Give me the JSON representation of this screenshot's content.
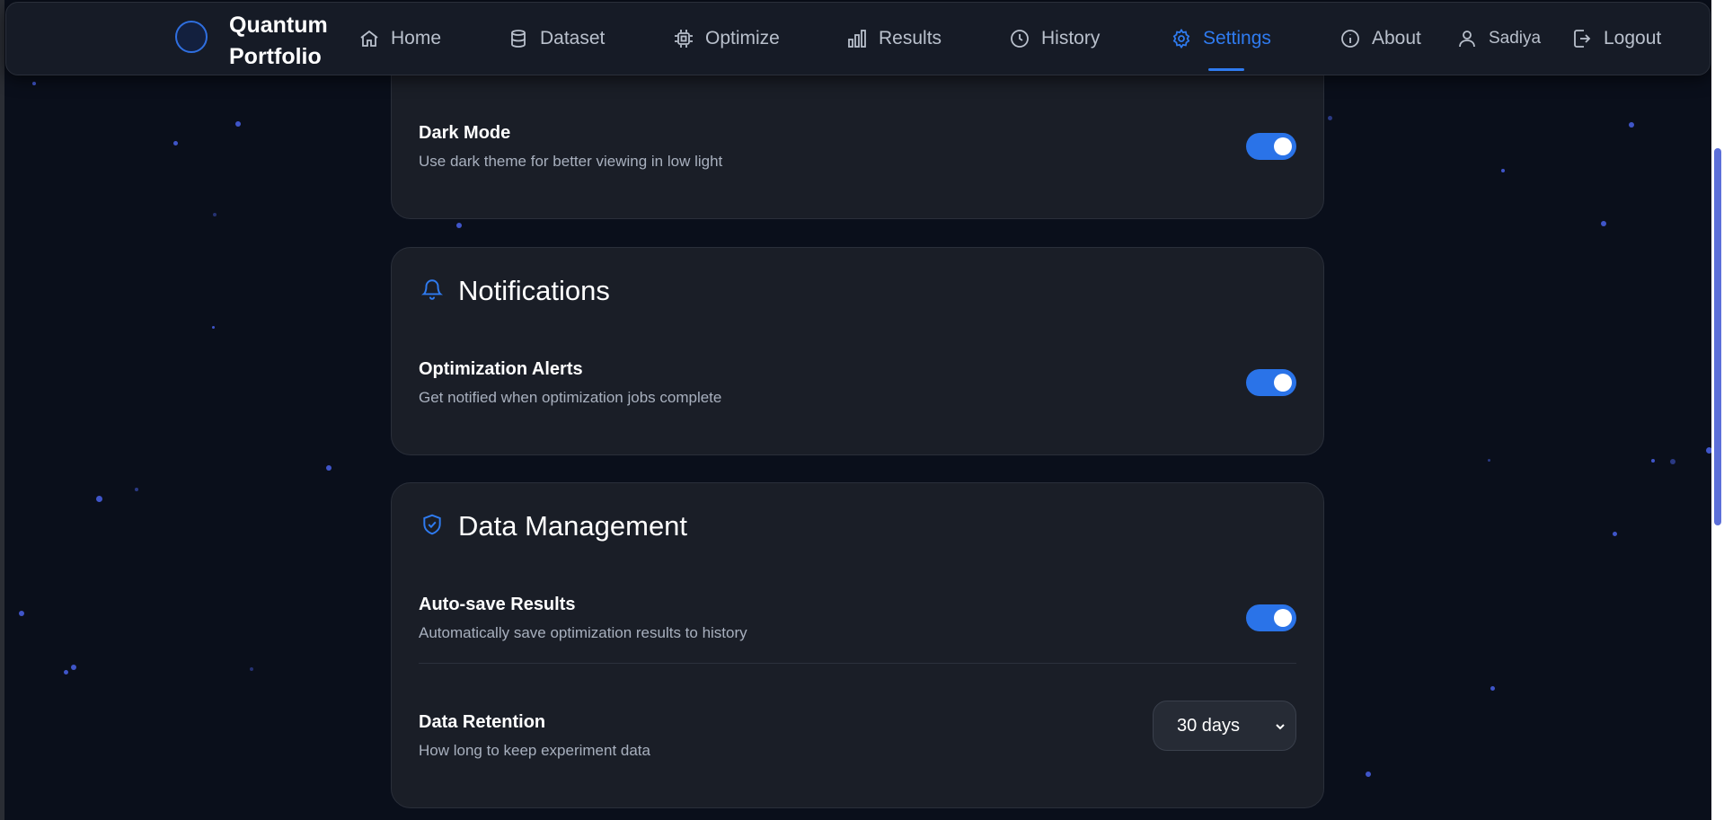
{
  "app": {
    "brand_line1": "Quantum",
    "brand_line2": "Portfolio"
  },
  "nav": {
    "items": [
      {
        "label": "Home",
        "icon": "home-icon"
      },
      {
        "label": "Dataset",
        "icon": "database-icon"
      },
      {
        "label": "Optimize",
        "icon": "cpu-icon"
      },
      {
        "label": "Results",
        "icon": "bar-chart-icon"
      },
      {
        "label": "History",
        "icon": "clock-icon"
      },
      {
        "label": "Settings",
        "icon": "gear-icon",
        "active": true
      }
    ],
    "about": "About",
    "user": "Sadiya",
    "logout": "Logout"
  },
  "appearance": {
    "dark_mode": {
      "title": "Dark Mode",
      "desc": "Use dark theme for better viewing in low light",
      "on": true
    }
  },
  "notifications": {
    "title": "Notifications",
    "optimization_alerts": {
      "title": "Optimization Alerts",
      "desc": "Get notified when optimization jobs complete",
      "on": true
    }
  },
  "data_management": {
    "title": "Data Management",
    "auto_save": {
      "title": "Auto-save Results",
      "desc": "Automatically save optimization results to history",
      "on": true
    },
    "retention": {
      "title": "Data Retention",
      "desc": "How long to keep experiment data",
      "value": "30 days"
    }
  },
  "colors": {
    "accent": "#2f7bf0",
    "background": "#0a0f1b",
    "card": "#1a1e27"
  }
}
